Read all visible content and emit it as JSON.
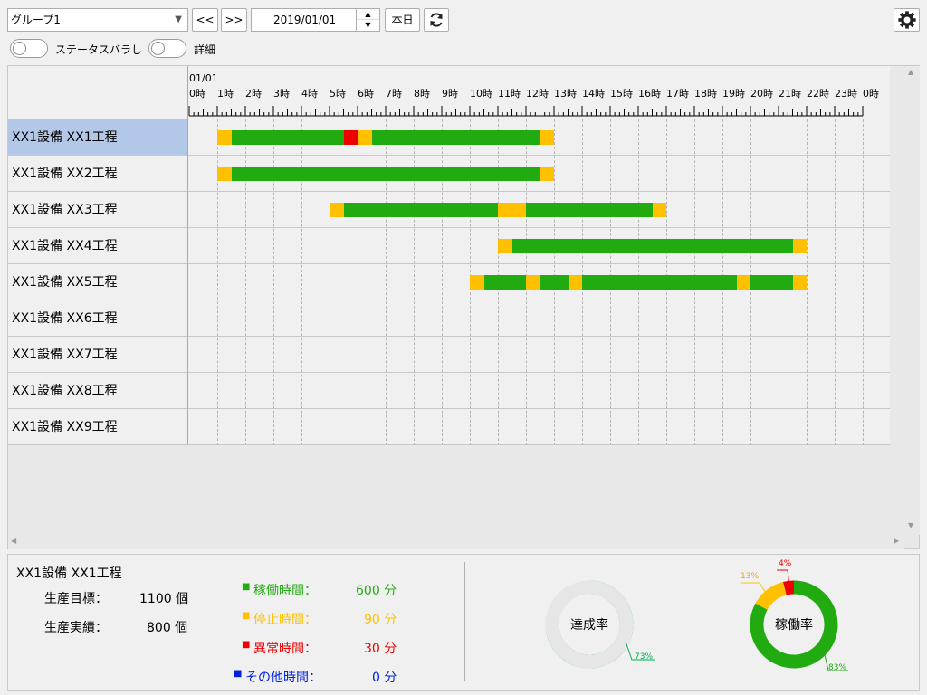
{
  "toolbar": {
    "group_select": "グループ1",
    "prev_label": "<<",
    "next_label": ">>",
    "date_value": "2019/01/01",
    "today_label": "本日"
  },
  "options": {
    "status_label": "ステータスバラし",
    "detail_label": "詳細"
  },
  "colors": {
    "run": "#22aa11",
    "stop": "#ffc000",
    "error": "#ee0000",
    "other": "#0022dd",
    "rate": "#00b050"
  },
  "timeline": {
    "date_label": "01/01",
    "hours": [
      "0時",
      "1時",
      "2時",
      "3時",
      "4時",
      "5時",
      "6時",
      "7時",
      "8時",
      "9時",
      "10時",
      "11時",
      "12時",
      "13時",
      "14時",
      "15時",
      "16時",
      "17時",
      "18時",
      "19時",
      "20時",
      "21時",
      "22時",
      "23時",
      "0時"
    ]
  },
  "rows": [
    {
      "label": "XX1設備 XX1工程",
      "selected": true,
      "segments": [
        {
          "s": 1,
          "e": 1.5,
          "st": "stop"
        },
        {
          "s": 1.5,
          "e": 5.5,
          "st": "run"
        },
        {
          "s": 5.5,
          "e": 6,
          "st": "error"
        },
        {
          "s": 6,
          "e": 6.5,
          "st": "stop"
        },
        {
          "s": 6.5,
          "e": 12.5,
          "st": "run"
        },
        {
          "s": 12.5,
          "e": 13,
          "st": "stop"
        }
      ]
    },
    {
      "label": "XX1設備 XX2工程",
      "segments": [
        {
          "s": 1,
          "e": 1.5,
          "st": "stop"
        },
        {
          "s": 1.5,
          "e": 12.5,
          "st": "run"
        },
        {
          "s": 12.5,
          "e": 13,
          "st": "stop"
        }
      ]
    },
    {
      "label": "XX1設備 XX3工程",
      "segments": [
        {
          "s": 5,
          "e": 5.5,
          "st": "stop"
        },
        {
          "s": 5.5,
          "e": 11,
          "st": "run"
        },
        {
          "s": 11,
          "e": 12,
          "st": "stop"
        },
        {
          "s": 12,
          "e": 16.5,
          "st": "run"
        },
        {
          "s": 16.5,
          "e": 17,
          "st": "stop"
        }
      ]
    },
    {
      "label": "XX1設備 XX4工程",
      "segments": [
        {
          "s": 11,
          "e": 11.5,
          "st": "stop"
        },
        {
          "s": 11.5,
          "e": 21.5,
          "st": "run"
        },
        {
          "s": 21.5,
          "e": 22,
          "st": "stop"
        }
      ]
    },
    {
      "label": "XX1設備 XX5工程",
      "segments": [
        {
          "s": 10,
          "e": 10.5,
          "st": "stop"
        },
        {
          "s": 10.5,
          "e": 12,
          "st": "run"
        },
        {
          "s": 12,
          "e": 12.5,
          "st": "stop"
        },
        {
          "s": 12.5,
          "e": 13.5,
          "st": "run"
        },
        {
          "s": 13.5,
          "e": 14,
          "st": "stop"
        },
        {
          "s": 14,
          "e": 19.5,
          "st": "run"
        },
        {
          "s": 19.5,
          "e": 20,
          "st": "stop"
        },
        {
          "s": 20,
          "e": 21.5,
          "st": "run"
        },
        {
          "s": 21.5,
          "e": 22,
          "st": "stop"
        }
      ]
    },
    {
      "label": "XX1設備 XX6工程",
      "segments": []
    },
    {
      "label": "XX1設備 XX7工程",
      "segments": []
    },
    {
      "label": "XX1設備 XX8工程",
      "segments": []
    },
    {
      "label": "XX1設備 XX9工程",
      "segments": []
    }
  ],
  "summary": {
    "title": "XX1設備 XX1工程",
    "target_label": "生産目標：",
    "target_value": "1100 個",
    "actual_label": "生産実績：",
    "actual_value": "800 個",
    "run_label": "稼働時間：",
    "run_value": "600 分",
    "stop_label": "停止時間：",
    "stop_value": "90 分",
    "error_label": "異常時間：",
    "error_value": "30 分",
    "other_label": "その他時間：",
    "other_value": "0 分",
    "bullet": "■"
  },
  "achievement": {
    "label": "達成率",
    "value": 73,
    "value_label": "73%"
  },
  "utilization": {
    "label": "稼働率",
    "slices": [
      {
        "name": "run",
        "value": 83,
        "label": "83%"
      },
      {
        "name": "stop",
        "value": 13,
        "label": "13%"
      },
      {
        "name": "error",
        "value": 4,
        "label": "4%"
      }
    ]
  }
}
